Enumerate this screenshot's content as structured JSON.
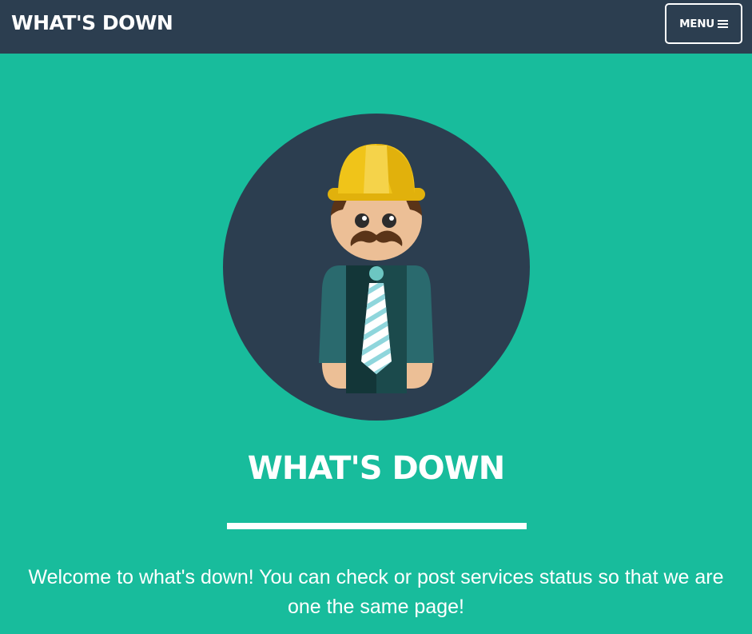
{
  "navbar": {
    "brand": "WHAT'S DOWN",
    "menu_label": "MENU",
    "menu_icon": "bars-icon"
  },
  "hero": {
    "avatar": "construction-worker-avatar",
    "title": "WHAT'S DOWN",
    "text": "Welcome to what's down! You can check or post services status so that we are one the same page!"
  },
  "colors": {
    "navbar_bg": "#2c3e50",
    "page_bg": "#18bc9c",
    "text": "#ffffff",
    "helmet": "#f0c419"
  }
}
